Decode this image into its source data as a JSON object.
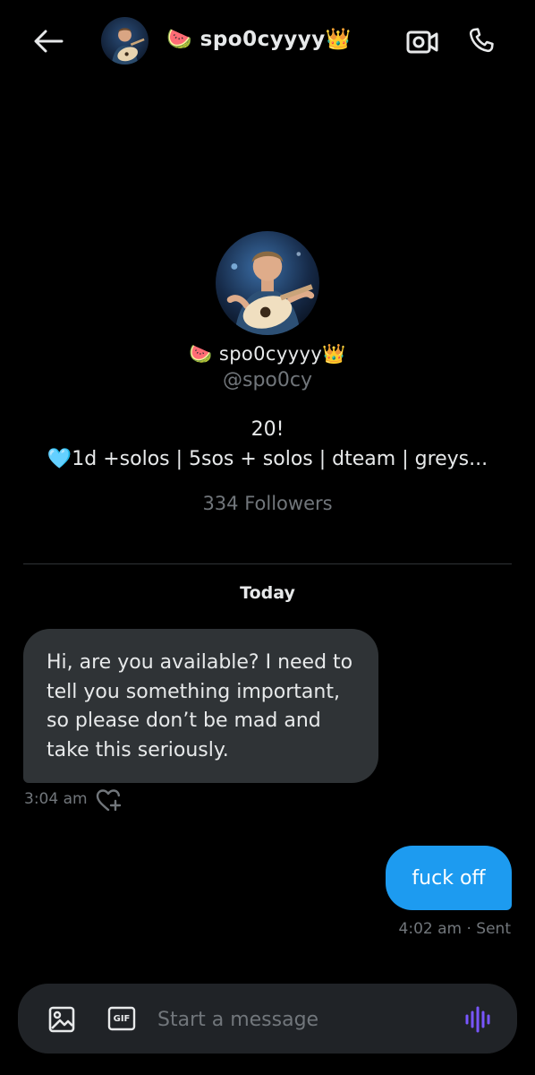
{
  "header": {
    "contact_name": "🍉 spo0cyyyy👑",
    "back_icon": "arrow-left-icon",
    "video_icon": "video-call-icon",
    "call_icon": "phone-icon"
  },
  "profile": {
    "name": "🍉 spo0cyyyy👑",
    "handle": "@spo0cy",
    "bio_line1": "20!",
    "bio_line2": "🩵1d +solos | 5sos + solos | dteam | greys...",
    "followers": "334 Followers"
  },
  "conversation": {
    "date_separator": "Today",
    "messages": [
      {
        "direction": "incoming",
        "text": "Hi, are you available? I need to tell you something important, so please don’t be mad and take this seriously.",
        "time": "3:04 am"
      },
      {
        "direction": "outgoing",
        "text": "fuck off",
        "status": "4:02 am · Sent"
      }
    ]
  },
  "composer": {
    "placeholder": "Start a message",
    "gif_label": "GIF"
  },
  "colors": {
    "background": "#000000",
    "incoming_bubble": "#2f3336",
    "outgoing_bubble": "#1d9bf0",
    "muted_text": "#71767b",
    "voice_accent": "#7856ff"
  }
}
